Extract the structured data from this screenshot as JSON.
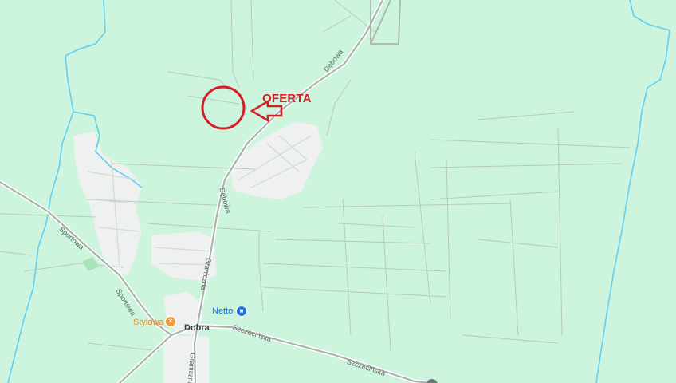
{
  "annotation": {
    "label": "OFERTA",
    "color": "#d41e26"
  },
  "places": {
    "town": "Dobra"
  },
  "pois": [
    {
      "name": "Netto",
      "icon": "shopping-bag-icon",
      "color": "#1a73e8"
    },
    {
      "name": "Stylowa",
      "icon": "restaurant-icon",
      "color": "#f29c38"
    }
  ],
  "roads": [
    {
      "name": "Dębowa"
    },
    {
      "name": "Dębowa"
    },
    {
      "name": "Graniczna"
    },
    {
      "name": "Graniczna"
    },
    {
      "name": "Sportowa"
    },
    {
      "name": "Sportowa"
    },
    {
      "name": "Szczecińska"
    },
    {
      "name": "Szczecińska"
    }
  ],
  "colors": {
    "land": "#cdf4dd",
    "built_area": "#eef1ef",
    "water": "#5fd0f0",
    "road": "#aab4ae"
  }
}
